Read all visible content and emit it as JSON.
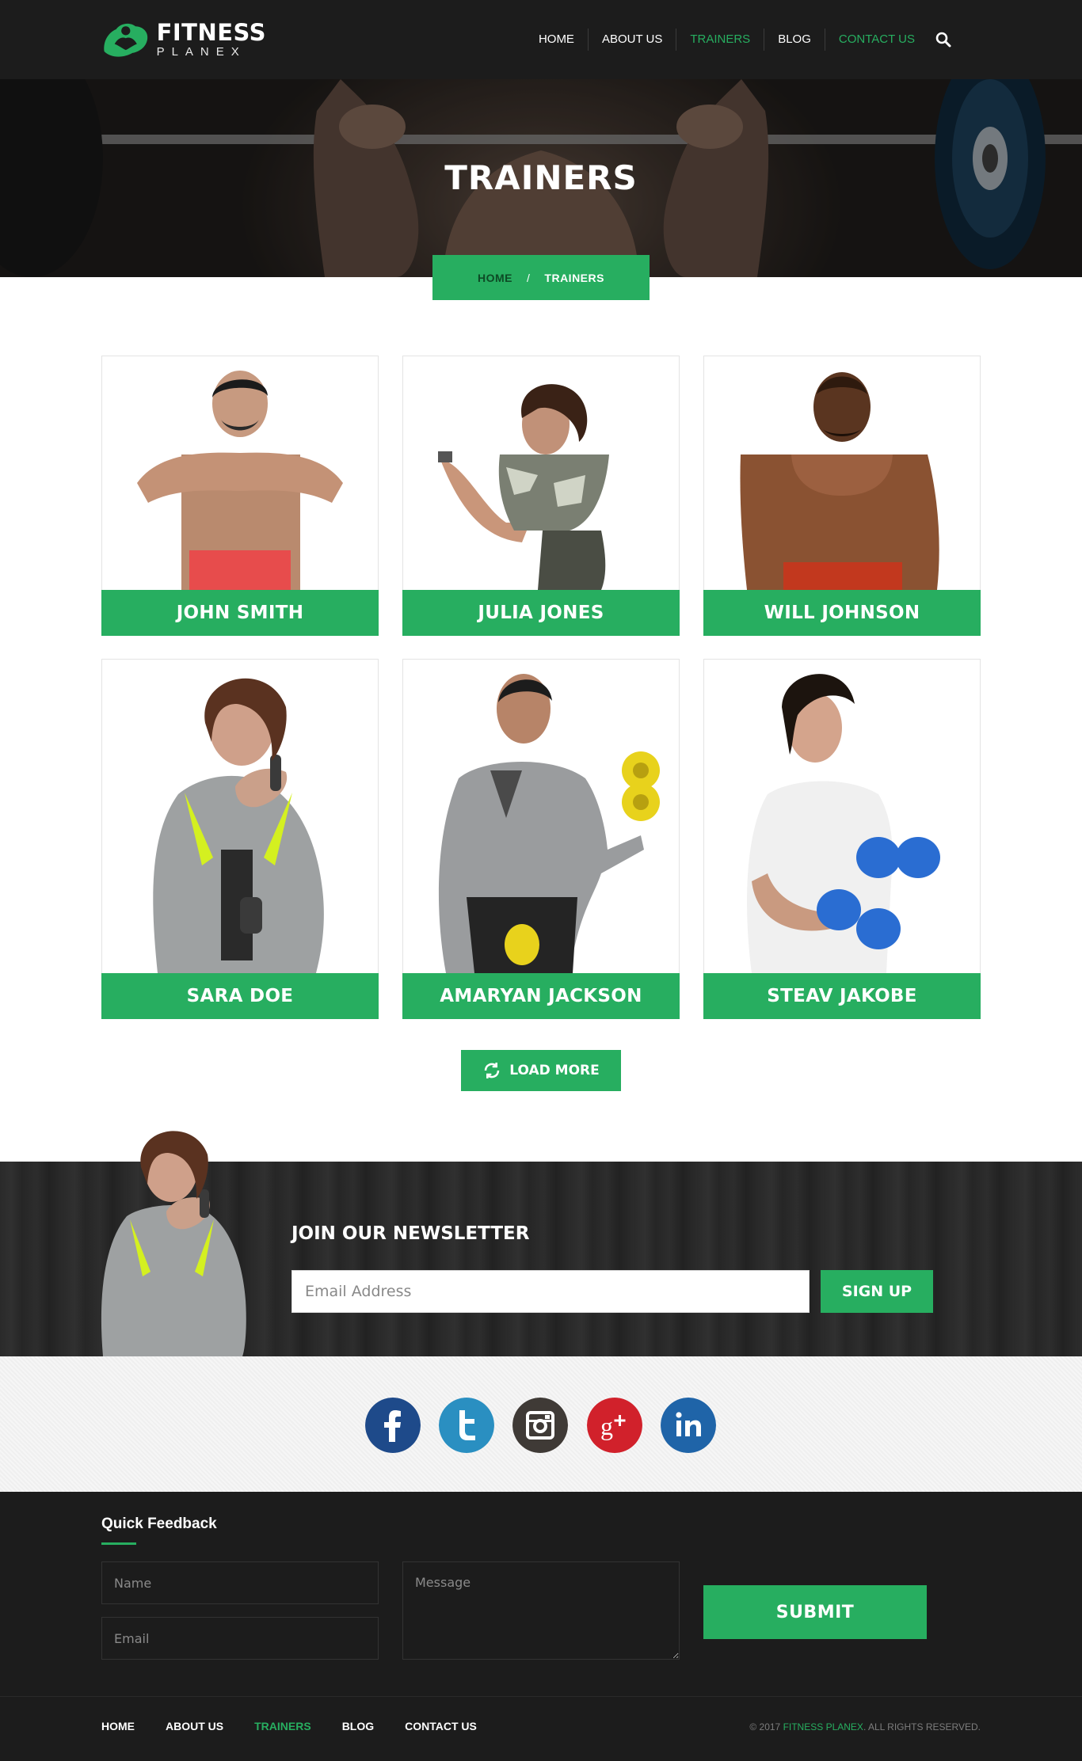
{
  "logo": {
    "main": "FITNESS",
    "sub": "PLANEX"
  },
  "nav": {
    "items": [
      {
        "label": "HOME",
        "active": false
      },
      {
        "label": "ABOUT US",
        "active": false
      },
      {
        "label": "TRAINERS",
        "active": true
      },
      {
        "label": "BLOG",
        "active": false
      },
      {
        "label": "CONTACT US",
        "active": true
      }
    ],
    "search_icon": "search-icon"
  },
  "hero": {
    "title": "TRAINERS",
    "breadcrumb": {
      "home": "HOME",
      "separator": "/",
      "current": "TRAINERS"
    }
  },
  "trainers": [
    {
      "name": "JOHN SMITH"
    },
    {
      "name": "JULIA JONES"
    },
    {
      "name": "WILL JOHNSON"
    },
    {
      "name": "SARA DOE"
    },
    {
      "name": "AMARYAN JACKSON"
    },
    {
      "name": "STEAV JAKOBE"
    }
  ],
  "load_more": {
    "label": "LOAD MORE",
    "icon": "refresh-icon"
  },
  "newsletter": {
    "title": "JOIN OUR NEWSLETTER",
    "email_placeholder": "Email Address",
    "button": "SIGN UP"
  },
  "social": [
    {
      "name": "facebook-icon",
      "color": "#1e4a8a"
    },
    {
      "name": "twitter-icon",
      "color": "#2a8fc1"
    },
    {
      "name": "instagram-icon",
      "color": "#3f3a36"
    },
    {
      "name": "google-plus-icon",
      "color": "#d1212b"
    },
    {
      "name": "linkedin-icon",
      "color": "#1f64a8"
    }
  ],
  "feedback": {
    "title": "Quick Feedback",
    "name_placeholder": "Name",
    "email_placeholder": "Email",
    "message_placeholder": "Message",
    "submit": "SUBMIT"
  },
  "footer": {
    "links": [
      {
        "label": "HOME",
        "active": false
      },
      {
        "label": "ABOUT US",
        "active": false
      },
      {
        "label": "TRAINERS",
        "active": true
      },
      {
        "label": "BLOG",
        "active": false
      },
      {
        "label": "CONTACT US",
        "active": false
      }
    ],
    "copyright_prefix": "© 2017",
    "copyright_brand": "FITNESS PLANEX",
    "copyright_suffix": ". ALL RIGHTS RESERVED."
  },
  "colors": {
    "accent": "#27ae60",
    "header_bg": "#1c1c1c",
    "footer_bg": "#1c1c1c"
  }
}
